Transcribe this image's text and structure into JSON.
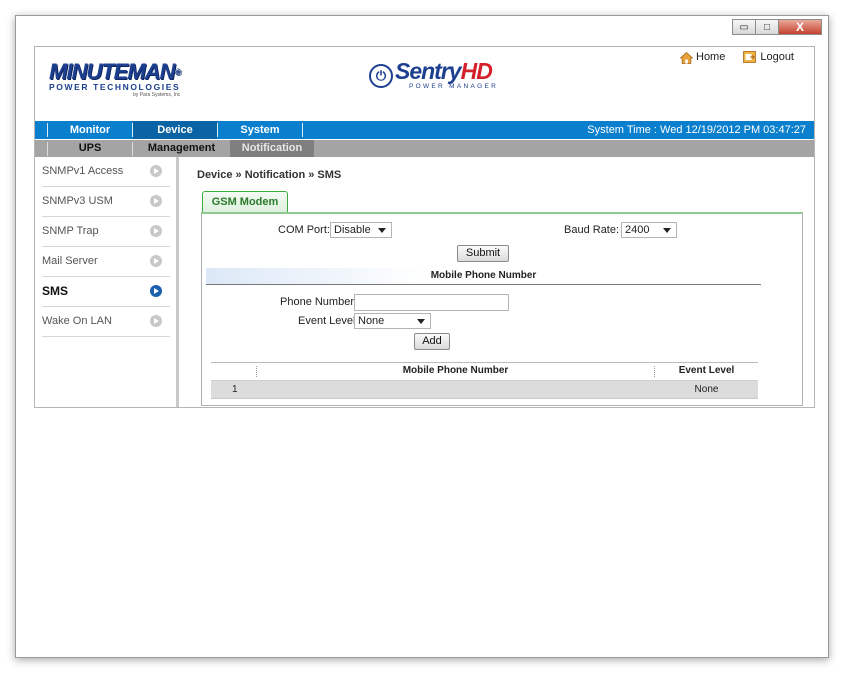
{
  "window_controls": {
    "minimize": "▭",
    "maximize": "□",
    "close": "X"
  },
  "header": {
    "brand_title": "MINUTEMAN",
    "brand_registered": "®",
    "brand_sub": "POWER TECHNOLOGIES",
    "brand_tiny": "by Para Systems, Inc",
    "product_name": "Sentry",
    "product_suffix": "HD",
    "product_sub": "POWER MANAGER",
    "home_label": "Home",
    "logout_label": "Logout"
  },
  "menu": {
    "items": [
      {
        "label": "Monitor"
      },
      {
        "label": "Device"
      },
      {
        "label": "System"
      }
    ],
    "system_time": "System Time : Wed 12/19/2012 PM 03:47:27"
  },
  "submenu": {
    "items": [
      {
        "label": "UPS"
      },
      {
        "label": "Management"
      },
      {
        "label": "Notification"
      }
    ]
  },
  "sidebar": {
    "items": [
      {
        "label": "SNMPv1 Access"
      },
      {
        "label": "SNMPv3 USM"
      },
      {
        "label": "SNMP Trap"
      },
      {
        "label": "Mail Server"
      },
      {
        "label": "SMS"
      },
      {
        "label": "Wake On LAN"
      }
    ]
  },
  "main": {
    "breadcrumb": "Device » Notification » SMS",
    "tab_label": "GSM Modem",
    "com_port_label": "COM Port:",
    "com_port_value": "Disable",
    "baud_rate_label": "Baud Rate:",
    "baud_rate_value": "2400",
    "submit_label": "Submit",
    "section_title": "Mobile Phone Number",
    "phone_label": "Phone Number:",
    "phone_value": "",
    "event_level_label": "Event Level:",
    "event_level_value": "None",
    "add_label": "Add",
    "table": {
      "columns": [
        "Mobile Phone Number",
        "Event Level"
      ],
      "rows": [
        {
          "index": "1",
          "phone": "",
          "level": "None"
        }
      ]
    }
  }
}
